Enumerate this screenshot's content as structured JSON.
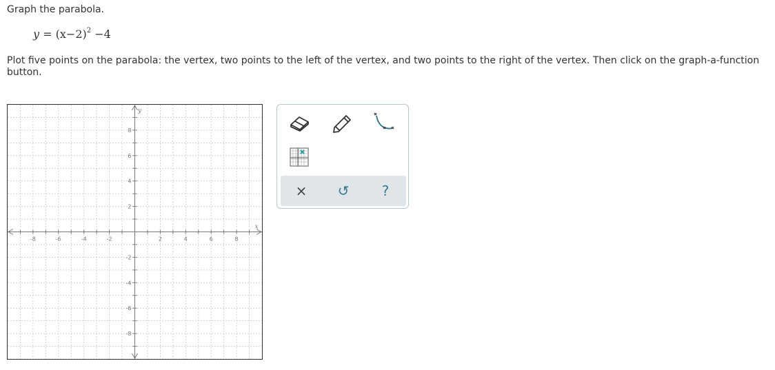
{
  "instructions": {
    "title": "Graph the parabola.",
    "equation": {
      "lhs": "y",
      "eq": "=",
      "base": "(x−2)",
      "exponent": "2",
      "tail": "−4"
    },
    "body": "Plot five points on the parabola: the vertex, two points to the left of the vertex, and two points to the right of the vertex. Then click on the graph-a-function button."
  },
  "graph": {
    "x_axis_label": "x",
    "y_axis_label": "y",
    "x_range": [
      -10,
      10
    ],
    "y_range": [
      -10,
      10
    ],
    "x_tick_labels": [
      {
        "value": -8,
        "text": "-8"
      },
      {
        "value": -6,
        "text": "-6"
      },
      {
        "value": -4,
        "text": "-4"
      },
      {
        "value": -2,
        "text": "-2"
      },
      {
        "value": 2,
        "text": "2"
      },
      {
        "value": 4,
        "text": "4"
      },
      {
        "value": 6,
        "text": "6"
      },
      {
        "value": 8,
        "text": "8"
      }
    ],
    "y_tick_labels": [
      {
        "value": 8,
        "text": "8"
      },
      {
        "value": 6,
        "text": "6"
      },
      {
        "value": 4,
        "text": "4"
      },
      {
        "value": 2,
        "text": "2"
      },
      {
        "value": -2,
        "text": "-2"
      },
      {
        "value": -4,
        "text": "-4"
      },
      {
        "value": -6,
        "text": "-6"
      },
      {
        "value": -8,
        "text": "-8"
      }
    ],
    "grid": true,
    "colors": {
      "grid": "#c8c8c8",
      "axis": "#777777"
    }
  },
  "toolbox": {
    "tools": [
      {
        "name": "eraser-tool",
        "icon": "eraser-icon"
      },
      {
        "name": "pencil-tool",
        "icon": "pencil-icon"
      },
      {
        "name": "graph-function-tool",
        "icon": "curve-icon"
      },
      {
        "name": "point-tool",
        "icon": "grid-point-icon"
      }
    ],
    "actions": {
      "clear": "×",
      "undo": "↺",
      "help": "?"
    },
    "accent_color": "#3b7b8c"
  }
}
